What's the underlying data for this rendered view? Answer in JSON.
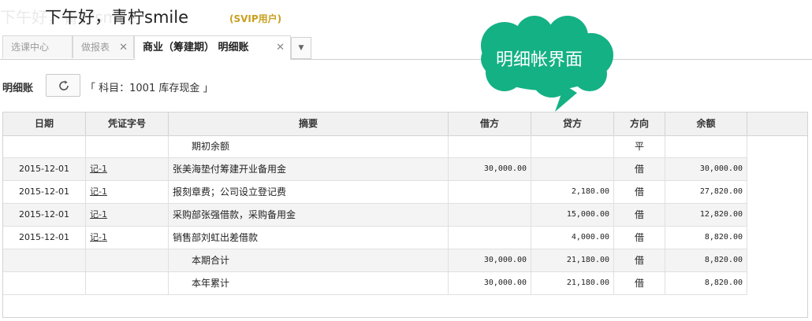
{
  "header": {
    "ghost_text": "下午好，青柠smile",
    "greeting": "下午好，青柠smile",
    "badge": "(SVIP用户)"
  },
  "tabs": [
    {
      "label": "选课中心",
      "closable": false,
      "active": false
    },
    {
      "label": "做报表",
      "closable": true,
      "active": false
    },
    {
      "label": "商业（筹建期） 明细账",
      "closable": true,
      "active": true
    }
  ],
  "callout": {
    "text": "明细帐界面",
    "color": "#14b184"
  },
  "toolbar": {
    "title": "明细账",
    "refresh_icon": "refresh-icon",
    "subject": "「 科目：1001 库存现金 」"
  },
  "ledger": {
    "columns": [
      "日期",
      "凭证字号",
      "摘要",
      "借方",
      "贷方",
      "方向",
      "余额"
    ],
    "rows": [
      {
        "date": "",
        "voucher": "",
        "summary": "期初余额",
        "debit": "",
        "credit": "",
        "direction": "平",
        "balance": ""
      },
      {
        "date": "2015-12-01",
        "voucher": "记-1",
        "summary": "张美海垫付筹建开业备用金",
        "debit": "30,000.00",
        "credit": "",
        "direction": "借",
        "balance": "30,000.00"
      },
      {
        "date": "2015-12-01",
        "voucher": "记-1",
        "summary": "报刻章费；公司设立登记费",
        "debit": "",
        "credit": "2,180.00",
        "direction": "借",
        "balance": "27,820.00"
      },
      {
        "date": "2015-12-01",
        "voucher": "记-1",
        "summary": "采购部张强借款，采购备用金",
        "debit": "",
        "credit": "15,000.00",
        "direction": "借",
        "balance": "12,820.00"
      },
      {
        "date": "2015-12-01",
        "voucher": "记-1",
        "summary": "销售部刘虹出差借款",
        "debit": "",
        "credit": "4,000.00",
        "direction": "借",
        "balance": "8,820.00"
      },
      {
        "date": "",
        "voucher": "",
        "summary": "本期合计",
        "debit": "30,000.00",
        "credit": "21,180.00",
        "direction": "借",
        "balance": "8,820.00"
      },
      {
        "date": "",
        "voucher": "",
        "summary": "本年累计",
        "debit": "30,000.00",
        "credit": "21,180.00",
        "direction": "借",
        "balance": "8,820.00"
      }
    ]
  }
}
